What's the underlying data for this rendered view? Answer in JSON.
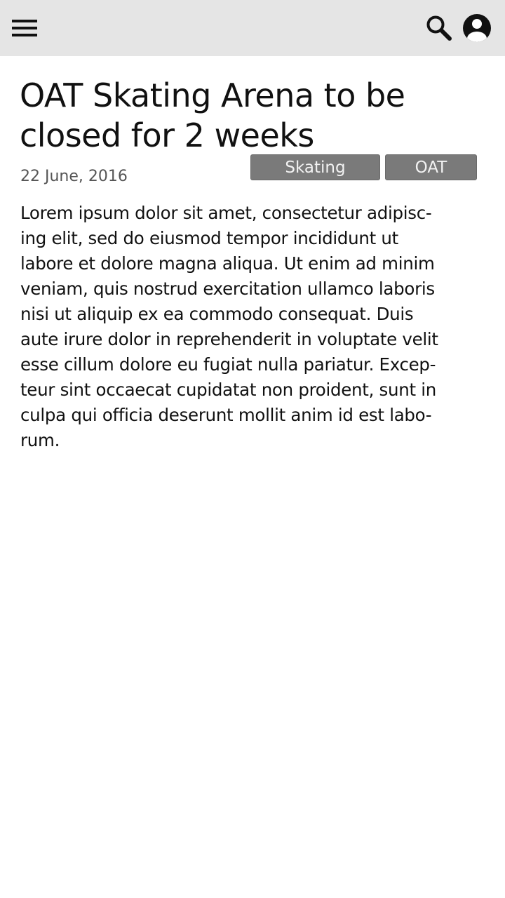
{
  "topbar": {
    "menu_icon": "hamburger-menu-icon",
    "search_icon": "search-icon",
    "account_icon": "account-circle-icon",
    "background": "#e5e5e5"
  },
  "article": {
    "title": "OAT Skating Arena to be closed for 2 weeks",
    "date": "22 June, 2016",
    "tags": [
      "Skating",
      "OAT"
    ],
    "tag_color": "#7a7a7a",
    "body": "Lorem ipsum dolor sit amet, consectetur adipisc-\ning elit, sed do eiusmod tempor incididunt ut\nlabore et dolore magna aliqua. Ut enim ad minim\nveniam, quis nostrud exercitation ullamco laboris\nnisi ut aliquip ex ea commodo consequat. Duis\naute irure dolor in reprehenderit in voluptate velit\nesse cillum dolore eu fugiat nulla pariatur. Excep-\nteur sint occaecat cupidatat non proident, sunt in\nculpa qui officia deserunt mollit anim id est labo-\nrum."
  }
}
